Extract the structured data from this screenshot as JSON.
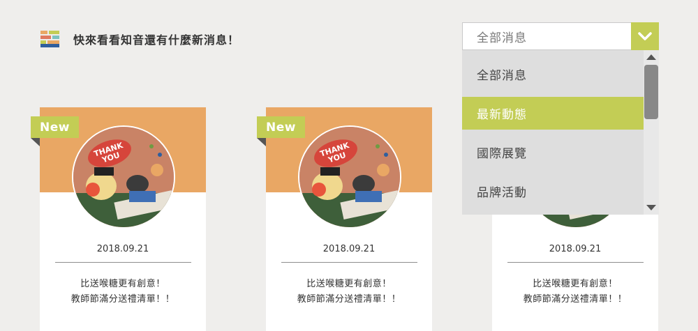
{
  "header": {
    "title": "快來看看知音還有什麼新消息！",
    "icon": "news-grid-icon"
  },
  "filter": {
    "selected": "全部消息",
    "options": [
      "全部消息",
      "最新動態",
      "國際展覽",
      "品牌活動"
    ],
    "highlighted_option": "最新動態"
  },
  "cards": [
    {
      "badge": "New",
      "date": "2018.09.21",
      "line1": "比送喉糖更有創意！",
      "line2": "教師節滿分送禮清單！！",
      "image": "thank-you-illustration"
    },
    {
      "badge": "New",
      "date": "2018.09.21",
      "line1": "比送喉糖更有創意！",
      "line2": "教師節滿分送禮清單！！",
      "image": "thank-you-illustration"
    },
    {
      "badge": "",
      "date": "2018.09.21",
      "line1": "比送喉糖更有創意！",
      "line2": "教師節滿分送禮清單！！",
      "image": "thank-you-illustration"
    }
  ],
  "colors": {
    "accent_green": "#c3cd55",
    "card_orange": "#e9a764",
    "background": "#efeeec"
  }
}
